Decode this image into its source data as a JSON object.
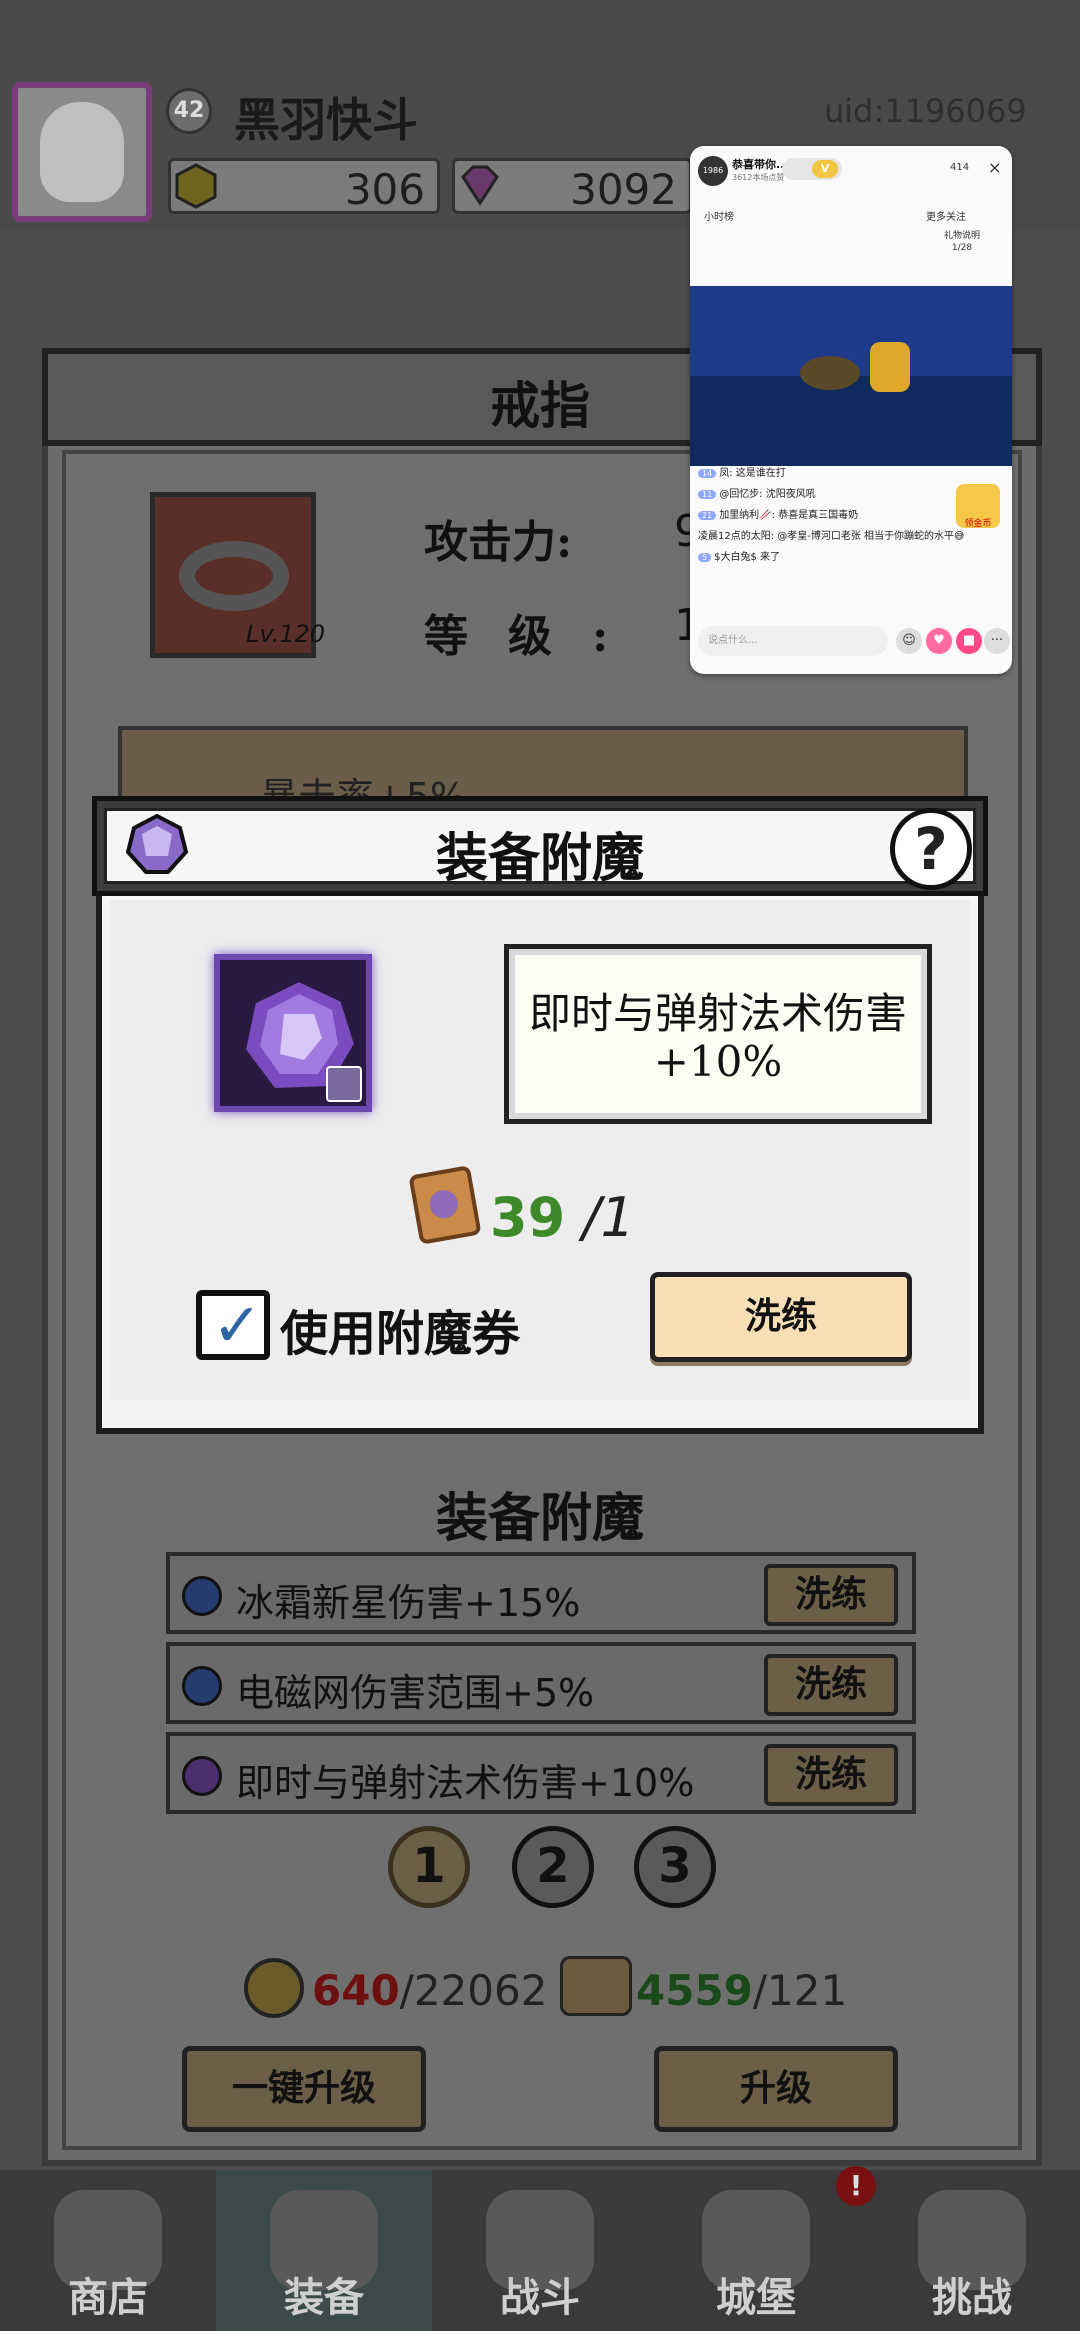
{
  "player": {
    "name": "黑羽快斗",
    "level": "42",
    "uid": "uid:1196069",
    "gold": "306",
    "gems": "3092"
  },
  "ring_panel": {
    "title": "戒指",
    "item_level": "Lv.120",
    "attack_label": "攻击力:",
    "attack_value": "9",
    "level_label": "等级:",
    "level_value": "1",
    "scroll_text": "暴击率+5%"
  },
  "dialog": {
    "title": "装备附魔",
    "help_label": "?",
    "description": "即时与弹射法术伤害+10%",
    "ticket_count": "39",
    "ticket_total": "/1",
    "use_ticket_label": "使用附魔券",
    "use_ticket_checked": true,
    "reroll_label": "洗练"
  },
  "enchant_section": {
    "title": "装备附魔",
    "rows": [
      {
        "text": "冰霜新星伤害+15%",
        "button": "洗练",
        "gem": "blue-gem-icon"
      },
      {
        "text": "电磁网伤害范围+5%",
        "button": "洗练",
        "gem": "blue-gem-icon"
      },
      {
        "text": "即时与弹射法术伤害+10%",
        "button": "洗练",
        "gem": "purple-gem-icon"
      }
    ],
    "pages": [
      "1",
      "2",
      "3"
    ],
    "active_page": "1"
  },
  "costs": {
    "coin_have": "640",
    "coin_need": "/22062",
    "scroll_have": "4559",
    "scroll_need": "/121"
  },
  "buttons": {
    "upgrade_all": "一键升级",
    "upgrade": "升级"
  },
  "nav": [
    {
      "label": "商店",
      "icon": "shop-icon"
    },
    {
      "label": "装备",
      "icon": "equipment-icon"
    },
    {
      "label": "战斗",
      "icon": "battle-icon"
    },
    {
      "label": "城堡",
      "icon": "castle-icon"
    },
    {
      "label": "挑战",
      "icon": "challenge-icon"
    }
  ],
  "nav_badge": "!",
  "stream": {
    "channel_name": "恭喜带你...",
    "channel_sub": "3612本场点赞",
    "avatar_text": "1986",
    "viewers": "414",
    "close": "×",
    "hour_rank": "小时榜",
    "more_follow": "更多关注",
    "gift_label": "礼物说明",
    "gift_progress": "1/28",
    "chat": [
      {
        "badge": "14",
        "text": "凤: 这是谁在打"
      },
      {
        "badge": "11",
        "text": "@回忆步: 沈阳夜风吼"
      },
      {
        "badge": "21",
        "text": "加里纳利🥢: 恭喜是真三国毒奶"
      },
      {
        "badge": "",
        "text": "凌晨12点的太阳: @孝皇-博河口老张 相当于你蹦蛇的水平😅"
      },
      {
        "badge": "5",
        "text": "$大白兔$ 来了"
      }
    ],
    "coin_label": "领金币",
    "input_placeholder": "说点什么...",
    "more_btn": "···"
  },
  "colors": {
    "accent_purple": "#6c49b2",
    "green": "#3e8a2a",
    "red": "#6e1010",
    "button_cream": "#f8dfb6"
  }
}
